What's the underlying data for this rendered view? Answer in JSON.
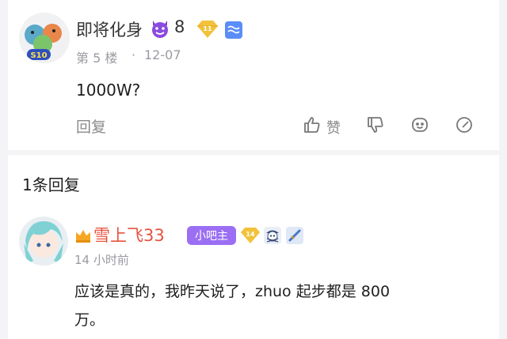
{
  "post": {
    "author": "即将化身",
    "level_number": "8",
    "badge_level": "11",
    "floor": "第 5 楼",
    "date": "12-07",
    "content": "1000W?",
    "reply_label": "回复",
    "like_label": "赞",
    "avatar_badge_text": "S10",
    "icons": [
      "devil-emoji-icon",
      "vip-diamond-icon",
      "wave-badge-icon",
      "thumbs-up-icon",
      "thumbs-down-icon",
      "emoji-icon",
      "edit-icon"
    ]
  },
  "replies": {
    "count_label": "1条回复",
    "reply": {
      "author": "雪上飞33",
      "role_badge": "小吧主",
      "badge_level": "14",
      "time": "14 小时前",
      "content_line1": "应该是真的，我昨天说了，zhuo 起步都是 800",
      "content_line2": "万。",
      "author_color": "#e8523f",
      "role_badge_color": "#9b6ff3",
      "icons": [
        "crown-icon",
        "vip-diamond-icon",
        "pirate-skull-icon",
        "sword-icon"
      ]
    }
  }
}
